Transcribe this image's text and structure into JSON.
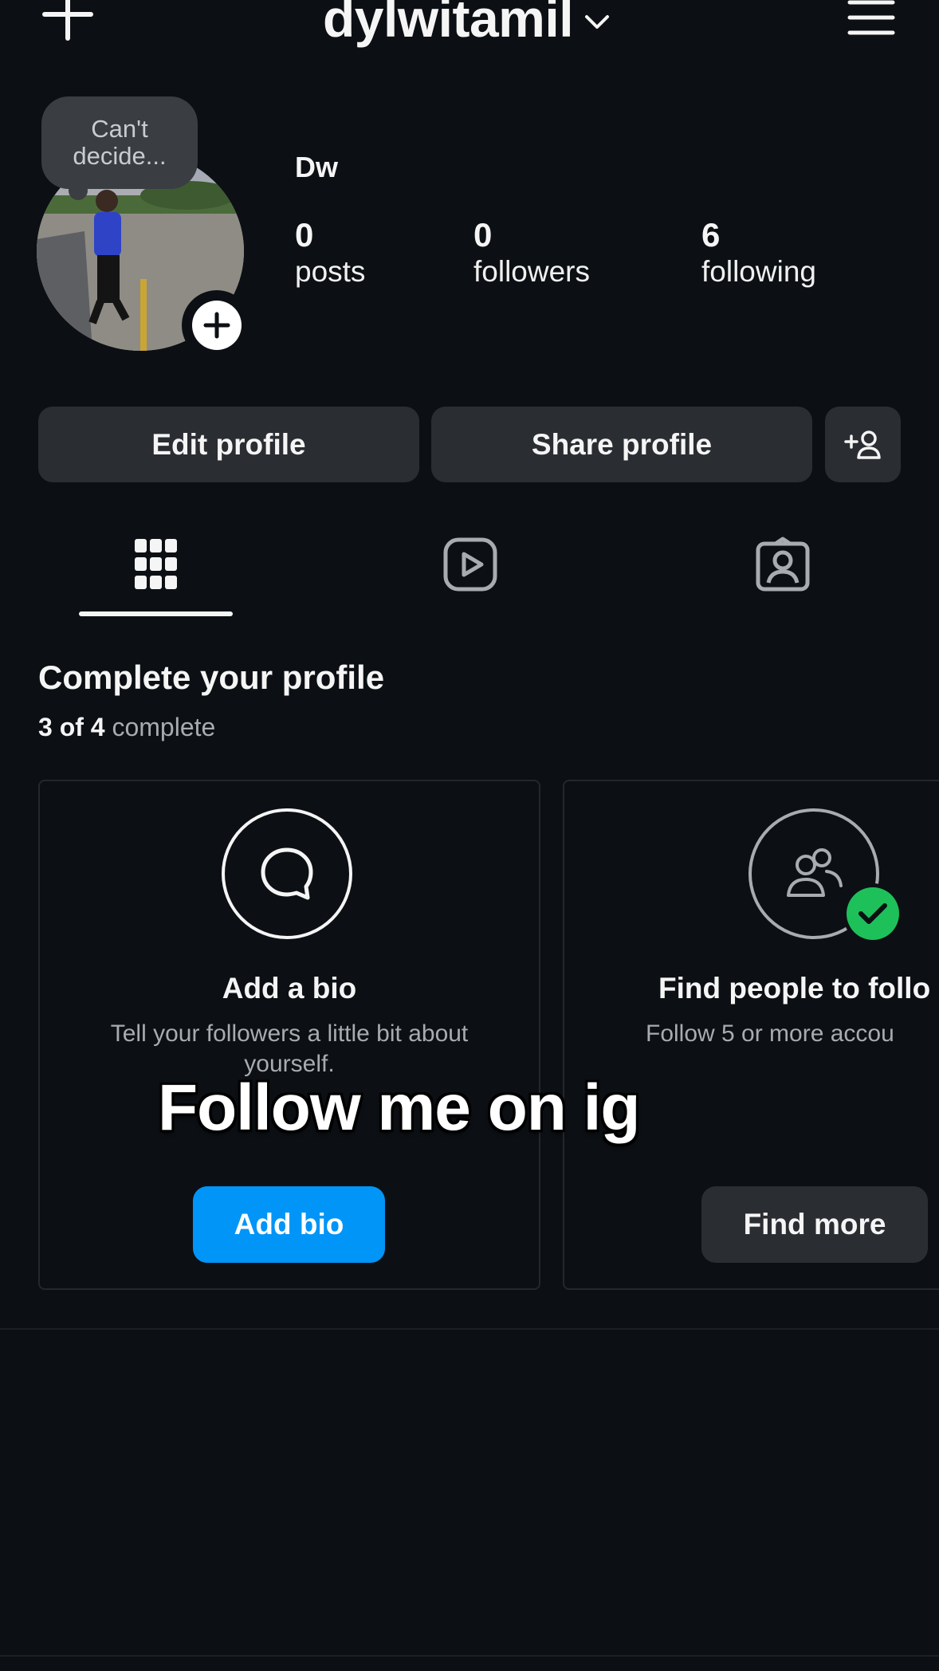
{
  "header": {
    "username": "dylwitamil",
    "new_icon": "plus-icon",
    "menu_icon": "hamburger-menu-icon",
    "dropdown_icon": "chevron-down-icon"
  },
  "profile": {
    "note": "Can't decide...",
    "display_name": "Dw",
    "stats": [
      {
        "value": "0",
        "label": "posts"
      },
      {
        "value": "0",
        "label": "followers"
      },
      {
        "value": "6",
        "label": "following"
      }
    ]
  },
  "actions": {
    "edit_label": "Edit profile",
    "share_label": "Share profile",
    "add_user_icon": "add-user-icon"
  },
  "tabs": [
    {
      "name": "posts",
      "icon": "grid-icon",
      "active": true
    },
    {
      "name": "reels",
      "icon": "reels-icon",
      "active": false
    },
    {
      "name": "tagged",
      "icon": "tagged-icon",
      "active": false
    }
  ],
  "complete_profile": {
    "title": "Complete your profile",
    "progress_done": "3 of 4",
    "progress_suffix": "complete",
    "cards": [
      {
        "icon": "speech-bubble-icon",
        "title": "Add a bio",
        "description": "Tell your followers a little bit about yourself.",
        "button": "Add bio",
        "completed": false
      },
      {
        "icon": "people-icon",
        "title": "Find people to follo",
        "description": "Follow 5 or more accou",
        "button": "Find more",
        "completed": true
      }
    ]
  },
  "overlay_caption": "Follow me on ig",
  "colors": {
    "background": "#0c1014",
    "button": "#2a2d31",
    "primary_blue": "#0095f6",
    "success_green": "#1ec05a",
    "muted_text": "#a8abb0"
  }
}
